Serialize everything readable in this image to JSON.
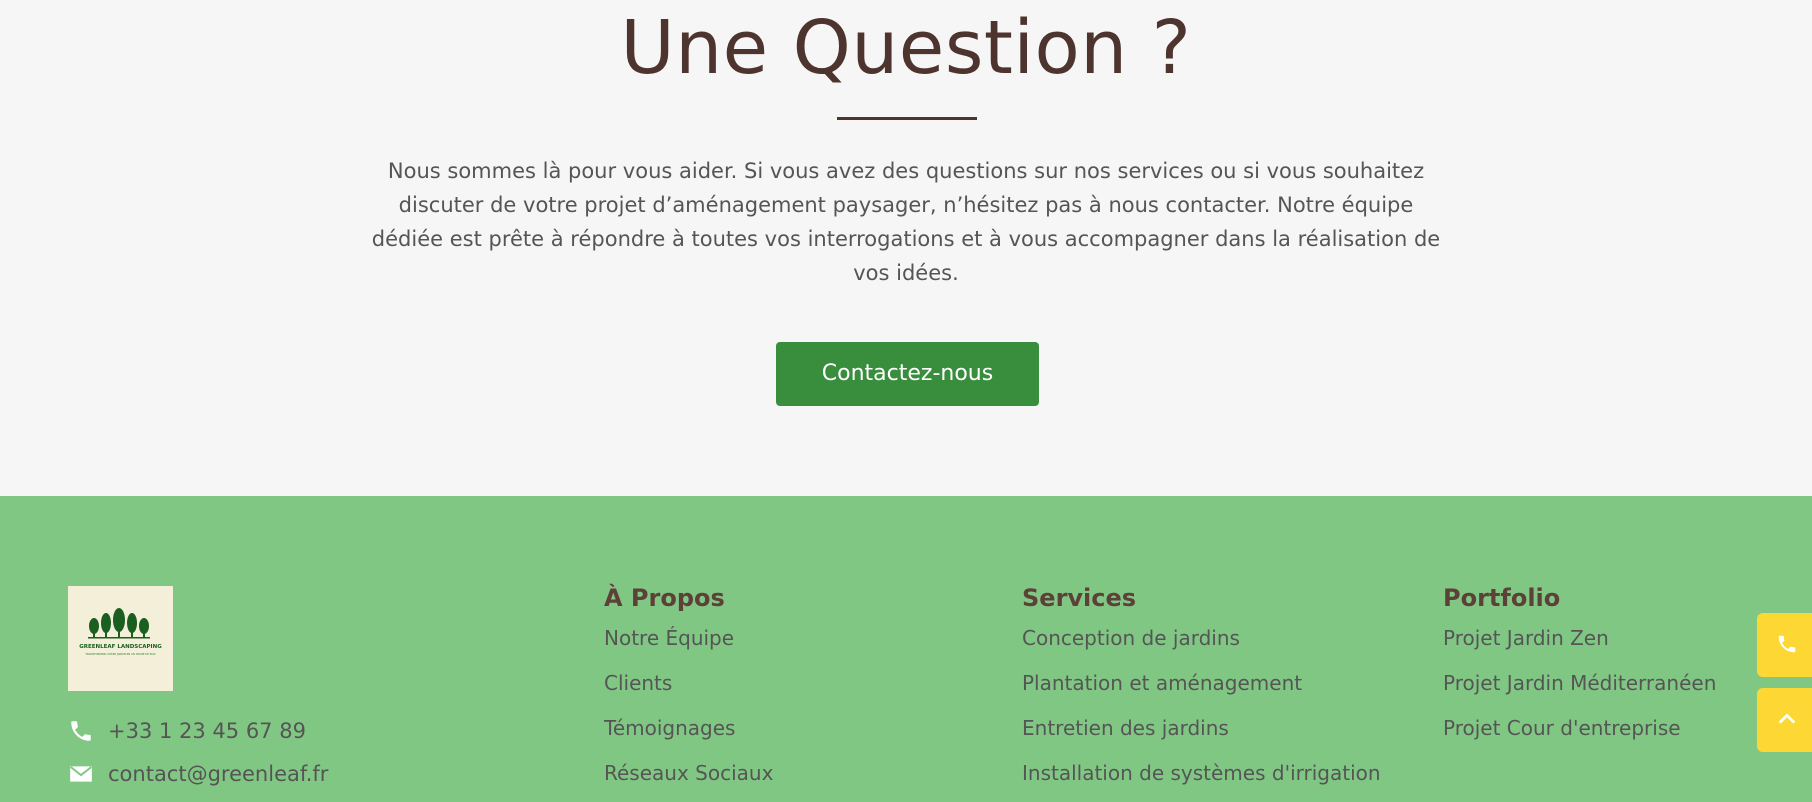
{
  "cta": {
    "title": "Une Question ?",
    "text": "Nous sommes là pour vous aider. Si vous avez des questions sur nos services ou si vous souhaitez discuter de votre projet d’aménagement paysager, n’hésitez pas à nous contacter. Notre équipe dédiée est prête à répondre à toutes vos interrogations et à vous accompagner dans la réalisation de vos idées.",
    "button_label": "Contactez-nous"
  },
  "footer": {
    "logo": {
      "name": "GREENLEAF LANDSCAPING",
      "tagline": "TRANSFORMING VOTRE JARDIN EN UN HAVRE DE PAIX"
    },
    "contact": {
      "phone": "+33 1 23 45 67 89",
      "email": "contact@greenleaf.fr"
    },
    "columns": {
      "about": {
        "title": "À Propos",
        "links": [
          "Notre Équipe",
          "Clients",
          "Témoignages",
          "Réseaux Sociaux"
        ]
      },
      "services": {
        "title": "Services",
        "links": [
          "Conception de jardins",
          "Plantation et aménagement",
          "Entretien des jardins",
          "Installation de systèmes d'irrigation"
        ]
      },
      "portfolio": {
        "title": "Portfolio",
        "links": [
          "Projet Jardin Zen",
          "Projet Jardin Méditerranéen",
          "Projet Cour d'entreprise"
        ]
      }
    }
  },
  "floating": {
    "phone_icon": "phone-icon",
    "top_icon": "chevron-up-icon"
  },
  "colors": {
    "title": "#4e342e",
    "button": "#388e3c",
    "footer_bg": "#81c784",
    "footer_heading": "#5d4037",
    "floating_bg": "#fdd835",
    "logo_green": "#1b5e20"
  }
}
